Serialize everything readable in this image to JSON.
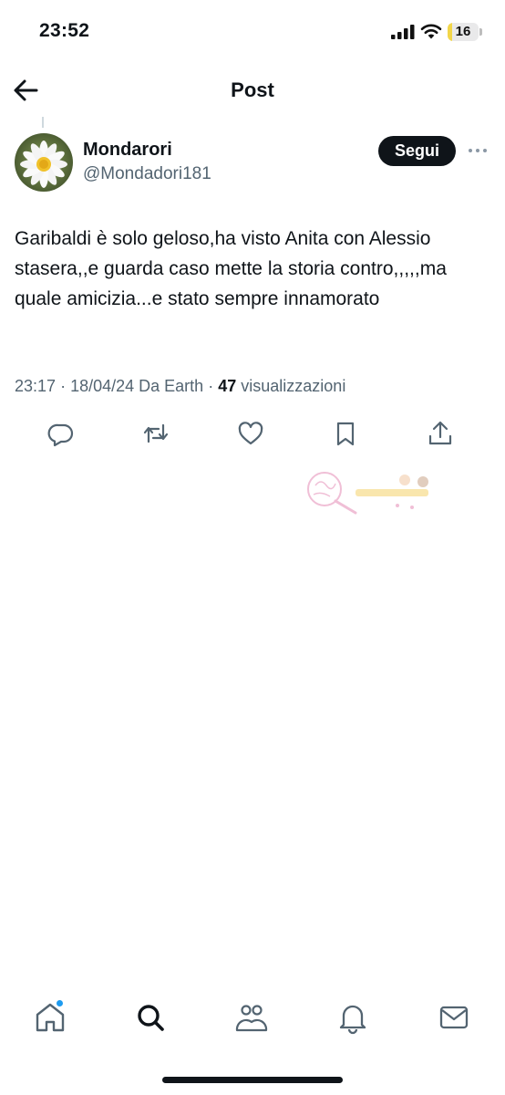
{
  "status_bar": {
    "time": "23:52",
    "battery_level": "16",
    "battery_fraction": 0.16
  },
  "nav": {
    "title": "Post",
    "back_icon": "arrow-left-icon"
  },
  "author": {
    "name": "Mondarori",
    "handle": "@Mondadori181",
    "avatar_icon": "daisy-flower-avatar",
    "follow_label": "Segui",
    "more_icon": "more-horizontal-icon"
  },
  "post": {
    "text": "Garibaldi è solo geloso,ha visto Anita con Alessio stasera,,e guarda caso mette la storia contro,,,,,ma quale amicizia...e stato sempre innamorato",
    "time": "23:17",
    "date": "18/04/24",
    "source": "Da Earth",
    "views_count": "47",
    "views_label": "visualizzazioni"
  },
  "actions": [
    {
      "name": "reply",
      "icon": "reply-icon"
    },
    {
      "name": "repost",
      "icon": "repost-icon"
    },
    {
      "name": "like",
      "icon": "heart-icon"
    },
    {
      "name": "bookmark",
      "icon": "bookmark-icon"
    },
    {
      "name": "share",
      "icon": "share-icon"
    }
  ],
  "tabbar": [
    {
      "name": "home",
      "icon": "home-icon",
      "has_badge": true
    },
    {
      "name": "search",
      "icon": "search-icon"
    },
    {
      "name": "communities",
      "icon": "communities-icon"
    },
    {
      "name": "notifications",
      "icon": "bell-icon"
    },
    {
      "name": "messages",
      "icon": "mail-icon"
    }
  ],
  "colors": {
    "text": "#0f1419",
    "secondary": "#536471",
    "accent": "#1d9bf0",
    "battery_fill": "#f2d649"
  }
}
